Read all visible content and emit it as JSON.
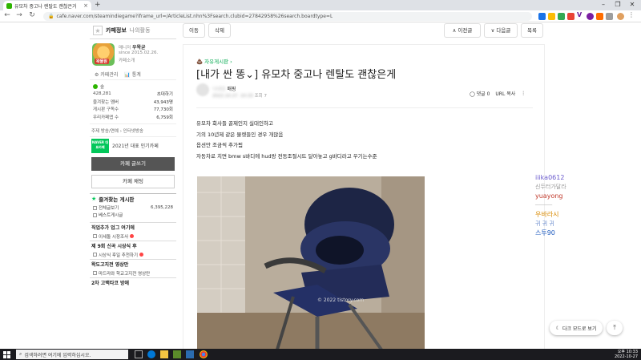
{
  "browser": {
    "tab_title": "유모차 중고나 렌탈도 괜찮은거",
    "new_tab_symbol": "+",
    "tab_close_symbol": "×",
    "url": "cafe.naver.com/steamindiegame?iframe_url=/ArticleList.nhn%3Fsearch.clubid=27842958%26search.boardtype=L",
    "window_controls": [
      "–",
      "❐",
      "✕"
    ],
    "nav_icons": [
      "←",
      "→",
      "↻"
    ],
    "extension_letters": [
      "V"
    ]
  },
  "sidebar": {
    "tabs": {
      "active": "카페정보",
      "inactive": "나의활동"
    },
    "profile": {
      "logo_text": "왁물원",
      "manager_label": "매니저",
      "manager_name": "우왁굳",
      "since": "since 2015.02.26.",
      "intro_link": "카페소개"
    },
    "manage_links": [
      "⚙ 카페관리",
      "📊 통계"
    ],
    "member_grade": "숲",
    "stats": [
      {
        "label": "428,281",
        "value": "초대하기"
      },
      {
        "label": "즐겨찾는 멤버",
        "value": "43,943명"
      },
      {
        "label": "게시판 구독수",
        "value": "77,730회"
      },
      {
        "label": "우리카페앱 수",
        "value": "6,759회"
      }
    ],
    "theme": "주제  방송/연예 › 인터넷방송",
    "award": {
      "badge": "NAVER 대표카페",
      "text": "2021년 대표 인기카페"
    },
    "write_button": "카페 글쓰기",
    "chat_button": "카페 채팅",
    "fav_section": {
      "title": "즐겨찾는 게시판"
    },
    "fav_boards": [
      {
        "name": "전체글보기",
        "count": "6,395,228"
      },
      {
        "name": "베스트게시글",
        "count": ""
      }
    ],
    "hot_sections": [
      {
        "title": "직업추가 업그 여기에",
        "items": [
          "이세돌 시장조사"
        ]
      },
      {
        "title": "제 9회 신곡 시상식 후",
        "items": [
          "시상식 후일 추천하기"
        ]
      },
      {
        "title": "왁도고지전 영상만",
        "items": [
          "마드라와 학교고지전 영상만"
        ]
      },
      {
        "title": "2차 고백타코 방에",
        "items": []
      }
    ]
  },
  "toolbar": {
    "move": "이동",
    "delete": "삭제",
    "prev": "∧ 이전글",
    "next": "∨ 다음글",
    "list": "목록"
  },
  "article": {
    "board_name": "자유게시판",
    "board_icon": "💩",
    "title": "[내가 싼 똥⌄] 유모차 중고나 렌탈도 괜찮은게",
    "author_suffix": "매핑",
    "author_blur": "닉네임",
    "meta_blur": "2022.10.27. 10:33",
    "views": "조회 7",
    "comments": "◯ 댓글 0",
    "url_copy": "URL 복사",
    "more": "⋮",
    "body_lines": [
      "유모차 회사들 골제인지 실대인하고",
      "기의 10년제 같은 물렛들인 경우 개많음",
      "옵션만 조금씩 추가됨",
      "자동차로 치면 bmw s바디에 hud랑 전동조절시트 달아놓고 g바디라고 우기는수준"
    ],
    "photo_watermark": "© 2022 tistory.com"
  },
  "right_panel": {
    "entries": [
      {
        "text": "iiika0612",
        "color": "#6a5acd",
        "kind": "name"
      },
      {
        "text": "신두터가달라",
        "color": "#999999",
        "kind": "sub"
      },
      {
        "text": "yuayong",
        "color": "#c0392b",
        "kind": "name"
      },
      {
        "text": "─────",
        "color": "#bbbbbb",
        "kind": "sub"
      },
      {
        "text": "우바라시",
        "color": "#d98a00",
        "kind": "name"
      },
      {
        "text": "귀 귀 귀",
        "color": "#6688cc",
        "kind": "sub"
      },
      {
        "text": "스투90",
        "color": "#1e5bbf",
        "kind": "name"
      }
    ],
    "dark_mode_button": "다크 모드로 보기",
    "top_button": "⤒"
  },
  "taskbar": {
    "search_placeholder": "검색하려면 여기에 입력하십시오.",
    "time": "오후 10:33",
    "date": "2022-10-27"
  },
  "colors": {
    "naver_green": "#03c75a",
    "taskbar": "#1b1b1f",
    "write_button": "#555555"
  }
}
